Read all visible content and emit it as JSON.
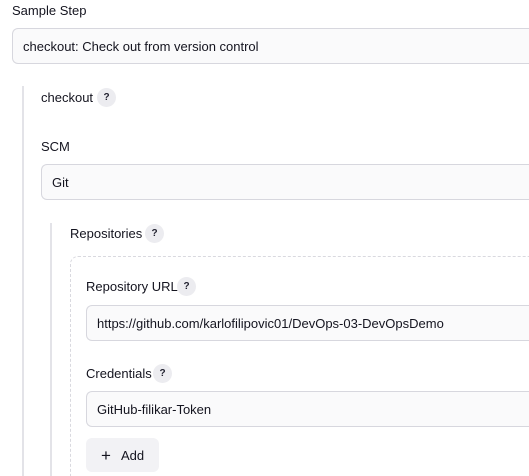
{
  "step": {
    "label": "Sample Step",
    "value": "checkout: Check out from version control"
  },
  "checkout": {
    "label": "checkout",
    "help": "?"
  },
  "scm": {
    "label": "SCM",
    "value": "Git"
  },
  "repositories": {
    "label": "Repositories",
    "help": "?",
    "url_label": "Repository URL",
    "url_help": "?",
    "url_value": "https://github.com/karlofilipovic01/DevOps-03-DevOpsDemo",
    "credentials_label": "Credentials",
    "credentials_help": "?",
    "credentials_value": "GitHub-filikar-Token",
    "add_icon": "+",
    "add_label": "Add"
  }
}
